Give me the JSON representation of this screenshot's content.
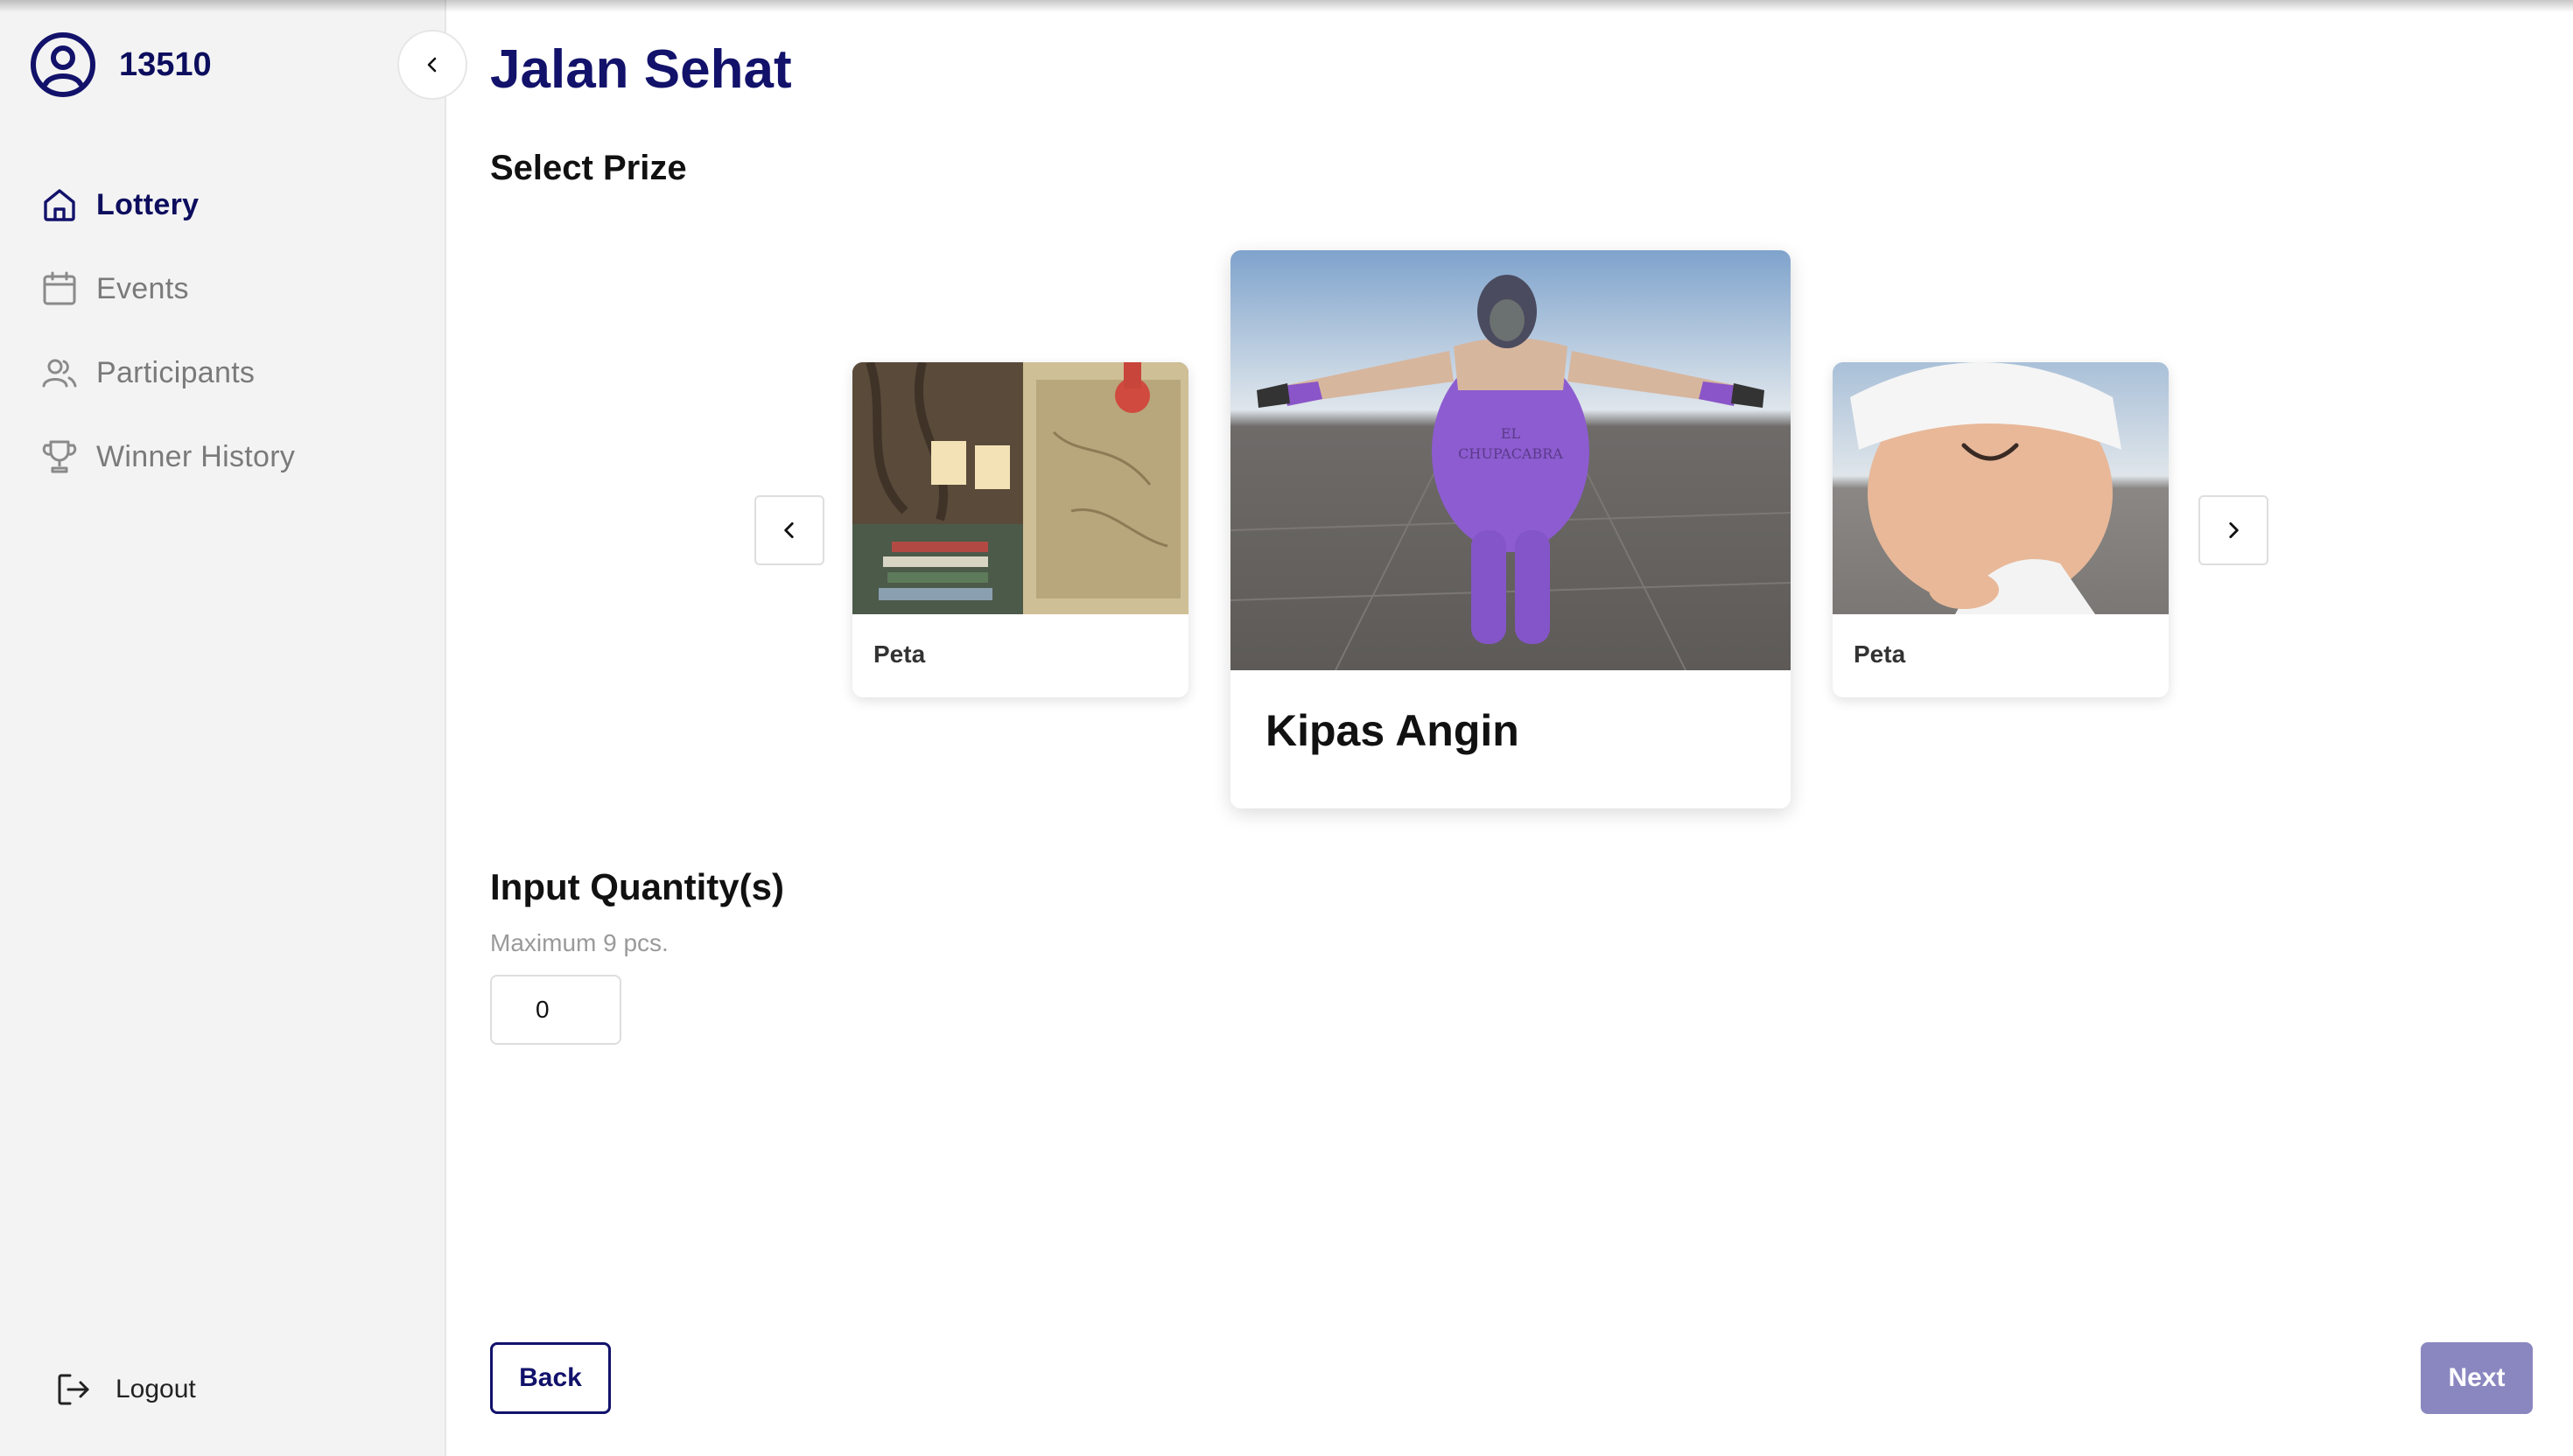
{
  "user": {
    "id": "13510"
  },
  "sidebar": {
    "items": [
      {
        "label": "Lottery",
        "icon": "home-icon",
        "active": true
      },
      {
        "label": "Events",
        "icon": "calendar-icon",
        "active": false
      },
      {
        "label": "Participants",
        "icon": "users-icon",
        "active": false
      },
      {
        "label": "Winner History",
        "icon": "trophy-icon",
        "active": false
      }
    ],
    "logout_label": "Logout"
  },
  "main": {
    "title": "Jalan Sehat",
    "select_prize_label": "Select Prize",
    "prizes": [
      {
        "name": "Peta",
        "image": "room-scene-image"
      },
      {
        "name": "Kipas Angin",
        "image": "wrestler-character-image",
        "selected": true,
        "image_text": "EL CHUPACABRA"
      },
      {
        "name": "Peta",
        "image": "chef-character-image"
      }
    ],
    "quantity_label": "Input Quantity(s)",
    "quantity_hint": "Maximum 9 pcs.",
    "quantity_value": "0",
    "back_label": "Back",
    "next_label": "Next"
  },
  "colors": {
    "brand": "#12126b",
    "next_disabled": "#8a87c0",
    "sidebar_bg": "#f3f3f3"
  }
}
